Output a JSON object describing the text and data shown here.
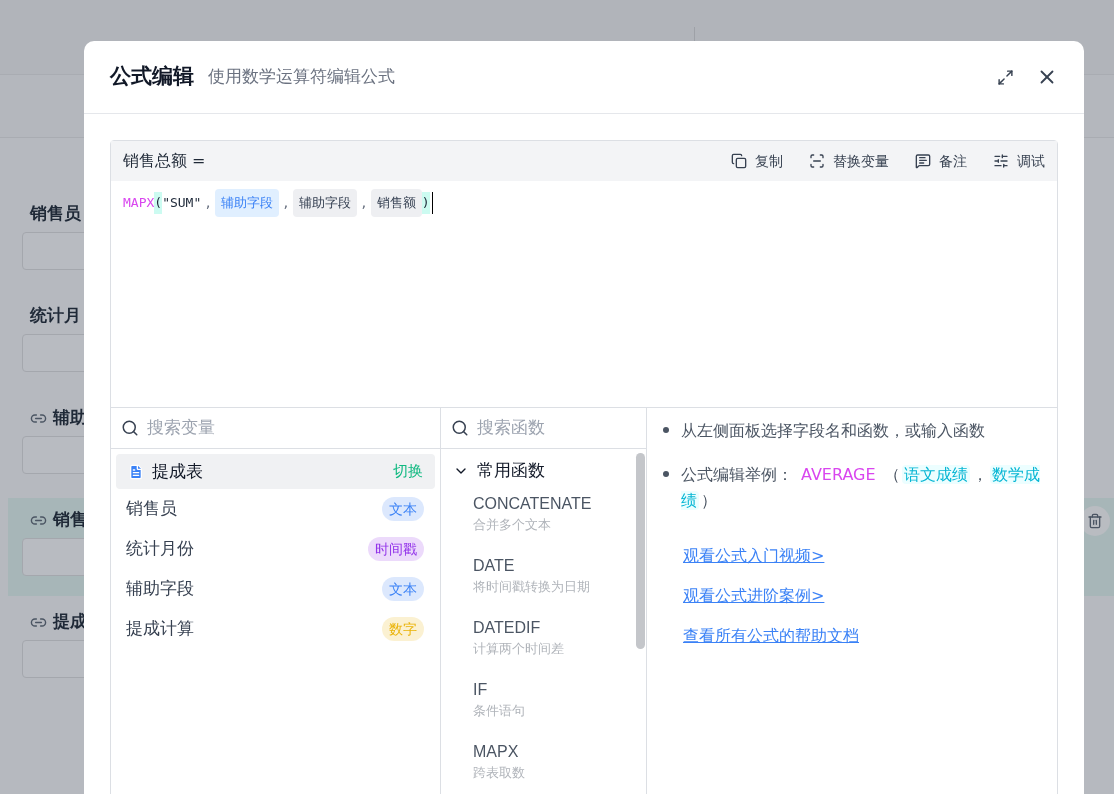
{
  "form_fields": [
    {
      "label": "销售员",
      "linked": false,
      "highlighted": false
    },
    {
      "label": "统计月",
      "linked": false,
      "highlighted": false
    },
    {
      "label": "辅助",
      "linked": true,
      "highlighted": false
    },
    {
      "label": "销售",
      "linked": true,
      "highlighted": true
    },
    {
      "label": "提成",
      "linked": true,
      "highlighted": false
    }
  ],
  "dialog": {
    "title": "公式编辑",
    "subtitle": "使用数学运算符编辑公式",
    "editor": {
      "target": "销售总额 =",
      "actions": [
        {
          "kind": "copy",
          "label": "复制"
        },
        {
          "kind": "replace",
          "label": "替换变量"
        },
        {
          "kind": "note",
          "label": "备注"
        },
        {
          "kind": "debug",
          "label": "调试"
        }
      ],
      "formula": [
        {
          "kind": "function",
          "text": "MAPX"
        },
        {
          "kind": "paren",
          "text": "("
        },
        {
          "kind": "string",
          "text": "\"SUM\""
        },
        {
          "kind": "comma",
          "text": ","
        },
        {
          "kind": "field",
          "text": "辅助字段",
          "highlighted": true
        },
        {
          "kind": "comma",
          "text": ","
        },
        {
          "kind": "field",
          "text": "辅助字段",
          "highlighted": false
        },
        {
          "kind": "comma",
          "text": ","
        },
        {
          "kind": "field",
          "text": "销售额",
          "highlighted": false
        },
        {
          "kind": "paren",
          "text": ")"
        }
      ]
    },
    "variables": {
      "placeholder": "搜索变量",
      "table": {
        "name": "提成表",
        "action": "切换"
      },
      "items": [
        {
          "name": "销售员",
          "type": "文本",
          "color": "#3b82f6"
        },
        {
          "name": "统计月份",
          "type": "时间戳",
          "color": "#9333ea"
        },
        {
          "name": "辅助字段",
          "type": "文本",
          "color": "#3b82f6"
        },
        {
          "name": "提成计算",
          "type": "数字",
          "color": "#eab308"
        }
      ]
    },
    "functions": {
      "placeholder": "搜索函数",
      "group": {
        "name": "常用函数",
        "expanded": true,
        "items": [
          {
            "name": "CONCATENATE",
            "description": "合并多个文本"
          },
          {
            "name": "DATE",
            "description": "将时间戳转换为日期"
          },
          {
            "name": "DATEDIF",
            "description": "计算两个时间差"
          },
          {
            "name": "IF",
            "description": "条件语句"
          },
          {
            "name": "MAPX",
            "description": "跨表取数"
          }
        ]
      }
    },
    "help": {
      "bullets": [
        [
          {
            "kind": "text",
            "text": "从左侧面板选择字段名和函数，或输入函数"
          }
        ],
        [
          {
            "kind": "text",
            "text": "公式编辑举例："
          },
          {
            "kind": "function",
            "text": "AVERAGE"
          },
          {
            "kind": "text",
            "text": "（"
          },
          {
            "kind": "field",
            "text": "语文成绩"
          },
          {
            "kind": "text",
            "text": "，"
          },
          {
            "kind": "field",
            "text": "数学成绩"
          },
          {
            "kind": "text",
            "text": "）"
          }
        ]
      ],
      "links": [
        "观看公式入门视频>",
        "观看公式进阶案例>",
        "查看所有公式的帮助文档"
      ]
    }
  }
}
